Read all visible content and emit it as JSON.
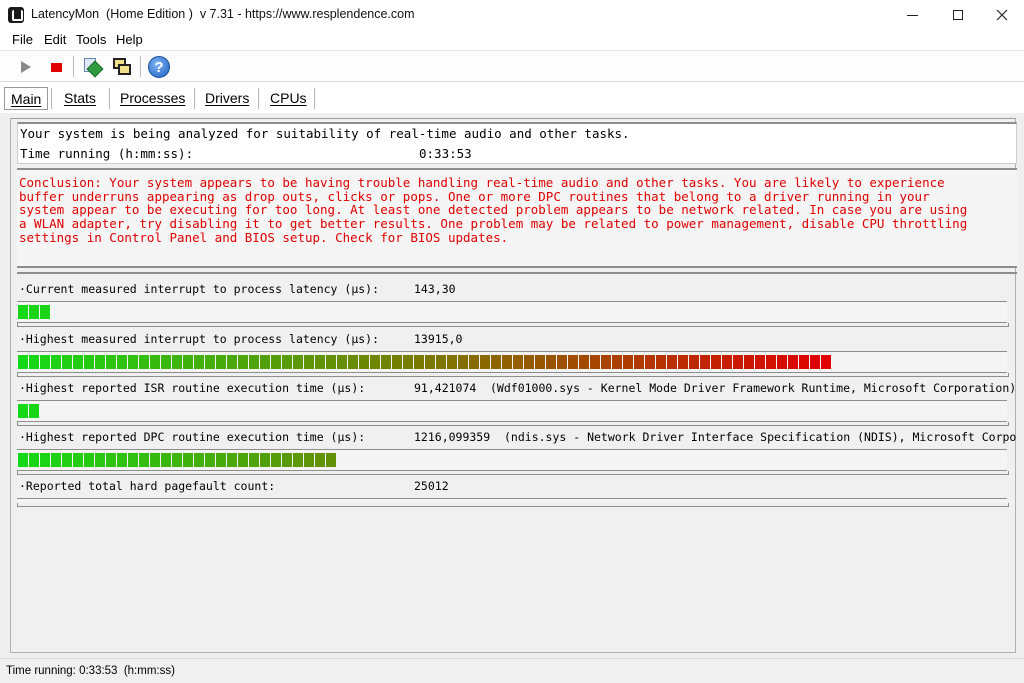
{
  "window": {
    "title": "LatencyMon  (Home Edition )  v 7.31 - https://www.resplendence.com",
    "icon": "latencymon-app-icon"
  },
  "menu": {
    "items": [
      "File",
      "Edit",
      "Tools",
      "Help"
    ]
  },
  "toolbar": {
    "buttons": [
      "play-icon",
      "stop-icon",
      "tools-icon",
      "windows-icon",
      "help-icon"
    ],
    "help_glyph": "?"
  },
  "tabs": [
    {
      "label": "Main",
      "active": true
    },
    {
      "label": "Stats",
      "active": false
    },
    {
      "label": "Processes",
      "active": false
    },
    {
      "label": "Drivers",
      "active": false
    },
    {
      "label": "CPUs",
      "active": false
    }
  ],
  "header": {
    "line1": "Your system is being analyzed for suitability of real-time audio and other tasks.",
    "time_label": "Time running (h:mm:ss):",
    "time_value": "0:33:53"
  },
  "conclusion": {
    "text": "Conclusion: Your system appears to be having trouble handling real-time audio and other tasks. You are likely to experience\nbuffer underruns appearing as drop outs, clicks or pops. One or more DPC routines that belong to a driver running in your\nsystem appear to be executing for too long. At least one detected problem appears to be network related. In case you are using\na WLAN adapter, try disabling it to get better results. One problem may be related to power management, disable CPU throttling\nsettings in Control Panel and BIOS setup. Check for BIOS updates."
  },
  "metrics": [
    {
      "label": "·Current measured interrupt to process latency (µs):",
      "value": "143,30",
      "detail": "",
      "bar_segments": 3
    },
    {
      "label": "·Highest measured interrupt to process latency (µs):",
      "value": "13915,0",
      "detail": "",
      "bar_segments": 74
    },
    {
      "label": "·Highest reported ISR routine execution time (µs):",
      "value": "91,421074",
      "detail": "(Wdf01000.sys - Kernel Mode Driver Framework Runtime, Microsoft Corporation)",
      "bar_segments": 2
    },
    {
      "label": "·Highest reported DPC routine execution time (µs):",
      "value": "1216,099359",
      "detail": "(ndis.sys - Network Driver Interface Specification (NDIS), Microsoft Corporation)",
      "bar_segments": 29
    },
    {
      "label": "·Reported total hard pagefault count:",
      "value": "25012",
      "detail": "",
      "bar_segments": 0
    }
  ],
  "statusbar": {
    "text": "Time running: 0:33:53  (h:mm:ss)"
  },
  "colors": {
    "conclusion_text": "#e00000",
    "bar_green": "#16d916",
    "bar_olive": "#7a7a00",
    "bar_red": "#e00000"
  }
}
